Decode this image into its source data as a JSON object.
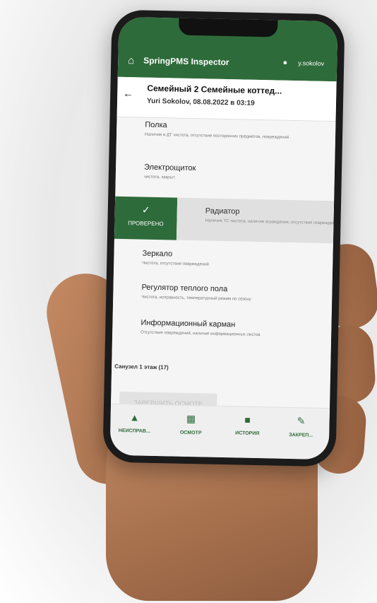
{
  "app": {
    "title": "SpringPMS Inspector",
    "user": "y.sokolov",
    "colors": {
      "primary": "#2e6b3a",
      "swipe_bg": "#2e6b3a",
      "disabled": "#e2e2e2"
    },
    "icons": {
      "home": "home-icon",
      "user": "user-icon",
      "back": "arrow-left-icon"
    }
  },
  "header": {
    "title": "Семейный 2 Семейные коттед...",
    "subtitle": "Yuri Sokolov, 08.08.2022 в 03:19"
  },
  "items": [
    {
      "name": "Полка",
      "desc": "Наличие в ДТ чистота, отсутствие посторонних предметов, повреждений"
    },
    {
      "name": "Электрощиток",
      "desc": "чистота, закрыт"
    },
    {
      "name": "Радиатор",
      "desc": "Наличие ТС чистота, наличие ограждения, отсутствие повреждений"
    },
    {
      "name": "Зеркало",
      "desc": "Чистота, отсутствие повреждений"
    },
    {
      "name": "Регулятор теплого пола",
      "desc": "Чистота, исправность, температурный режим по сезону"
    },
    {
      "name": "Информационный карман",
      "desc": "Отсутствие повреждений, наличие информационных листов"
    }
  ],
  "swipe_action": {
    "label": "ПРОВЕРЕНО",
    "icon": "check-icon"
  },
  "section_label": "Санузел 1 этаж (17)",
  "finish_button": "ЗАВЕРШИТЬ ОСМОТР",
  "bottom_nav": [
    {
      "label": "НЕИСПРАВ...",
      "icon": "warning-icon"
    },
    {
      "label": "ОСМОТР",
      "icon": "calendar-icon"
    },
    {
      "label": "ИСТОРИЯ",
      "icon": "chat-icon"
    },
    {
      "label": "ЗАКРЕП...",
      "icon": "wrench-icon"
    }
  ]
}
